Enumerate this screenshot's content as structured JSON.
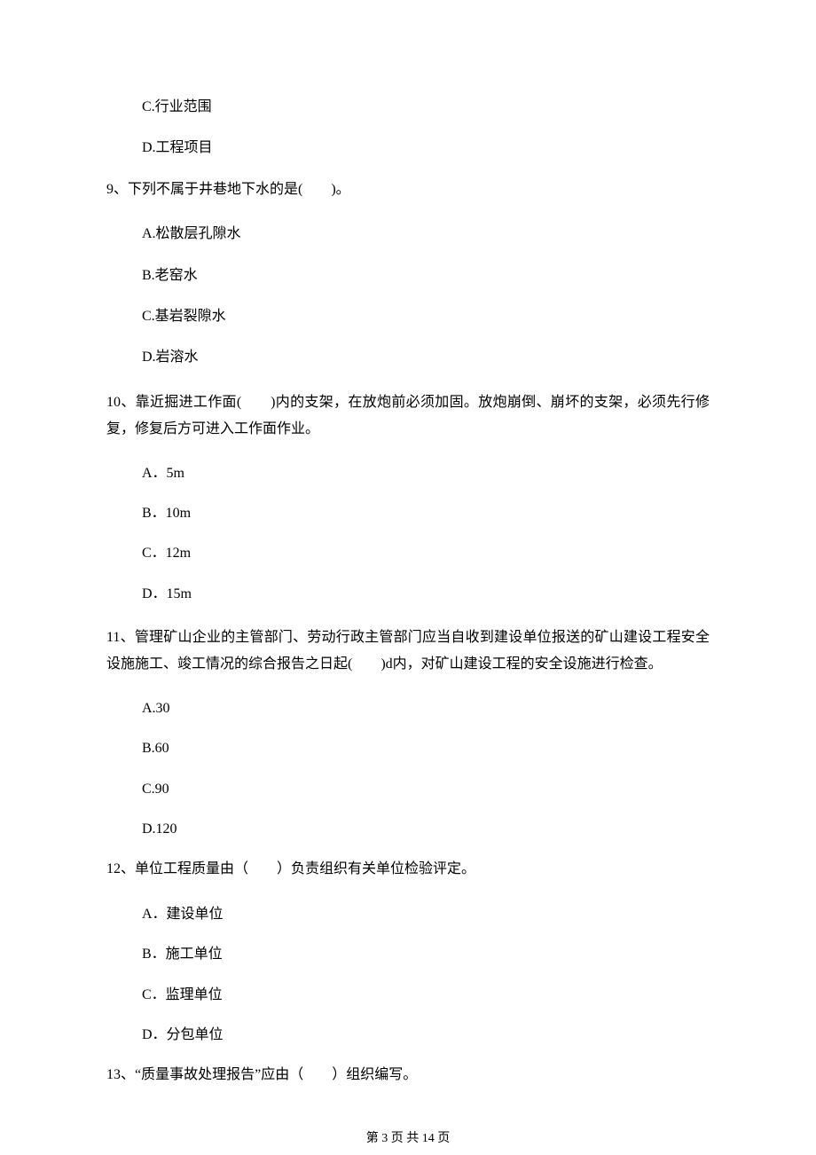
{
  "prev": {
    "opt_c": "C.行业范围",
    "opt_d": "D.工程项目"
  },
  "q9": {
    "stem": "9、下列不属于井巷地下水的是(　　)。",
    "opt_a": "A.松散层孔隙水",
    "opt_b": "B.老窑水",
    "opt_c": "C.基岩裂隙水",
    "opt_d": "D.岩溶水"
  },
  "q10": {
    "stem": "10、靠近掘进工作面(　　)内的支架，在放炮前必须加固。放炮崩倒、崩坏的支架，必须先行修复，修复后方可进入工作面作业。",
    "opt_a": "A．5m",
    "opt_b": "B．10m",
    "opt_c": "C．12m",
    "opt_d": "D．15m"
  },
  "q11": {
    "stem": "11、管理矿山企业的主管部门、劳动行政主管部门应当自收到建设单位报送的矿山建设工程安全设施施工、竣工情况的综合报告之日起(　　)d内，对矿山建设工程的安全设施进行检查。",
    "opt_a": "A.30",
    "opt_b": "B.60",
    "opt_c": "C.90",
    "opt_d": "D.120"
  },
  "q12": {
    "stem": "12、单位工程质量由（　　）负责组织有关单位检验评定。",
    "opt_a": "A．建设单位",
    "opt_b": "B．施工单位",
    "opt_c": "C．监理单位",
    "opt_d": "D．分包单位"
  },
  "q13": {
    "stem": "13、“质量事故处理报告”应由（　　）组织编写。"
  },
  "footer": "第 3 页 共 14 页"
}
